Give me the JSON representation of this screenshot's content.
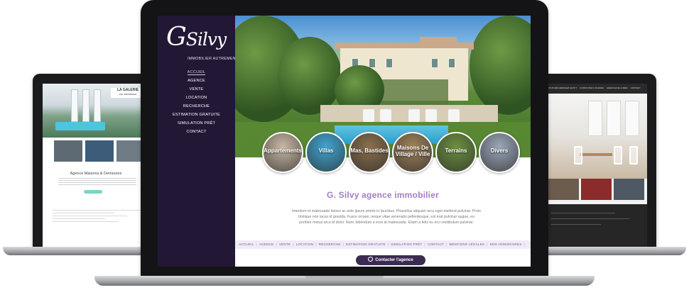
{
  "brand": {
    "initial": "G",
    "name": "Silvy",
    "tagline": "IMMOBILIER AUTREMENT"
  },
  "menu": [
    {
      "label": "ACCUEIL",
      "active": true
    },
    {
      "label": "AGENCE"
    },
    {
      "label": "VENTE"
    },
    {
      "label": "LOCATION"
    },
    {
      "label": "RECHERCHE"
    },
    {
      "label": "ESTIMATION GRATUITE"
    },
    {
      "label": "SIMULATION PRÊT"
    },
    {
      "label": "CONTACT"
    }
  ],
  "categories": [
    {
      "label": "Appartements",
      "color": "#c9b8a3"
    },
    {
      "label": "Villas",
      "color": "#3fa4d1"
    },
    {
      "label": "Mas, Bastides",
      "color": "#8a6f4c"
    },
    {
      "label": "Maisons De Village / Ville",
      "color": "#a08158"
    },
    {
      "label": "Terrains",
      "color": "#6b8f3e"
    },
    {
      "label": "Divers",
      "color": "#9aa6b8"
    }
  ],
  "content": {
    "title": "G. Silvy agence immobilier",
    "text": "Interdum et malesuada fames ac ante ipsum primis in faucibus. Phasellus aliquam arcu eget eleifend pulvinar. Proin tristique non lacus id gravida. Fusce ornare, neque vitae venenatis pellentesque, est erat pulvinar augue, eu porttitor metus arcu id dolor. Nunc bibendum a eros at malesuada. Etiam a felis eu orci vestibulum pulvinar."
  },
  "footer_nav": [
    "ACCUEIL",
    "AGENCE",
    "VENTE",
    "LOCATION",
    "RECHERCHE",
    "ESTIMATION GRATUITE",
    "SIMULATION PRÊT",
    "CONTACT",
    "MENTIONS LÉGALES",
    "NOS HONORAIRES"
  ],
  "contact_button": "Contacter l'agence",
  "left_site": {
    "logo": "LA GALERIE",
    "logo_sub": "DE L'IMMOBILIER",
    "title": "Agence Maisons & Demeures",
    "thumbs": [
      "",
      "",
      ""
    ]
  },
  "right_site": {
    "nav": [
      "VOUS RECHERCHEZ QUOI ?",
      "CONTACTEZ L'AGENCE",
      "AGENCE DE LA MER",
      "CONTACT"
    ]
  },
  "colors": {
    "sidebar": "#231736",
    "accent": "#a47dc7",
    "button": "#3b2b52"
  }
}
